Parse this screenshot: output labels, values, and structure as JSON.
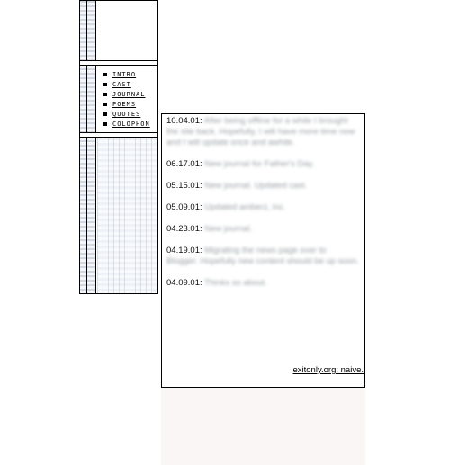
{
  "nav": {
    "items": [
      {
        "label": "INTRO"
      },
      {
        "label": "CAST"
      },
      {
        "label": "JOURNAL"
      },
      {
        "label": "POEMS"
      },
      {
        "label": "QUOTES"
      },
      {
        "label": "COLOPHON"
      }
    ]
  },
  "entries": [
    {
      "date": "10.04.01:",
      "text": "After being offline for a while I brought the site back. Hopefully, I will have more time now and I will update once and awhile."
    },
    {
      "date": "06.17.01:",
      "text": "New journal for Father's Day."
    },
    {
      "date": "05.15.01:",
      "text": "New journal. Updated cast."
    },
    {
      "date": "05.09.01:",
      "text": "Updated amberz, inc."
    },
    {
      "date": "04.23.01:",
      "text": "New journal."
    },
    {
      "date": "04.19.01:",
      "text": "Migrating the news page over to Blogger. Hopefully new content should be up soon."
    },
    {
      "date": "04.09.01:",
      "text": "Thinks so about."
    }
  ],
  "footer": {
    "link": "exitonly.org: naive."
  },
  "colors": {
    "border": "#000000",
    "strip": "#cfd8e2",
    "lower_bg": "#fbf6f6"
  }
}
